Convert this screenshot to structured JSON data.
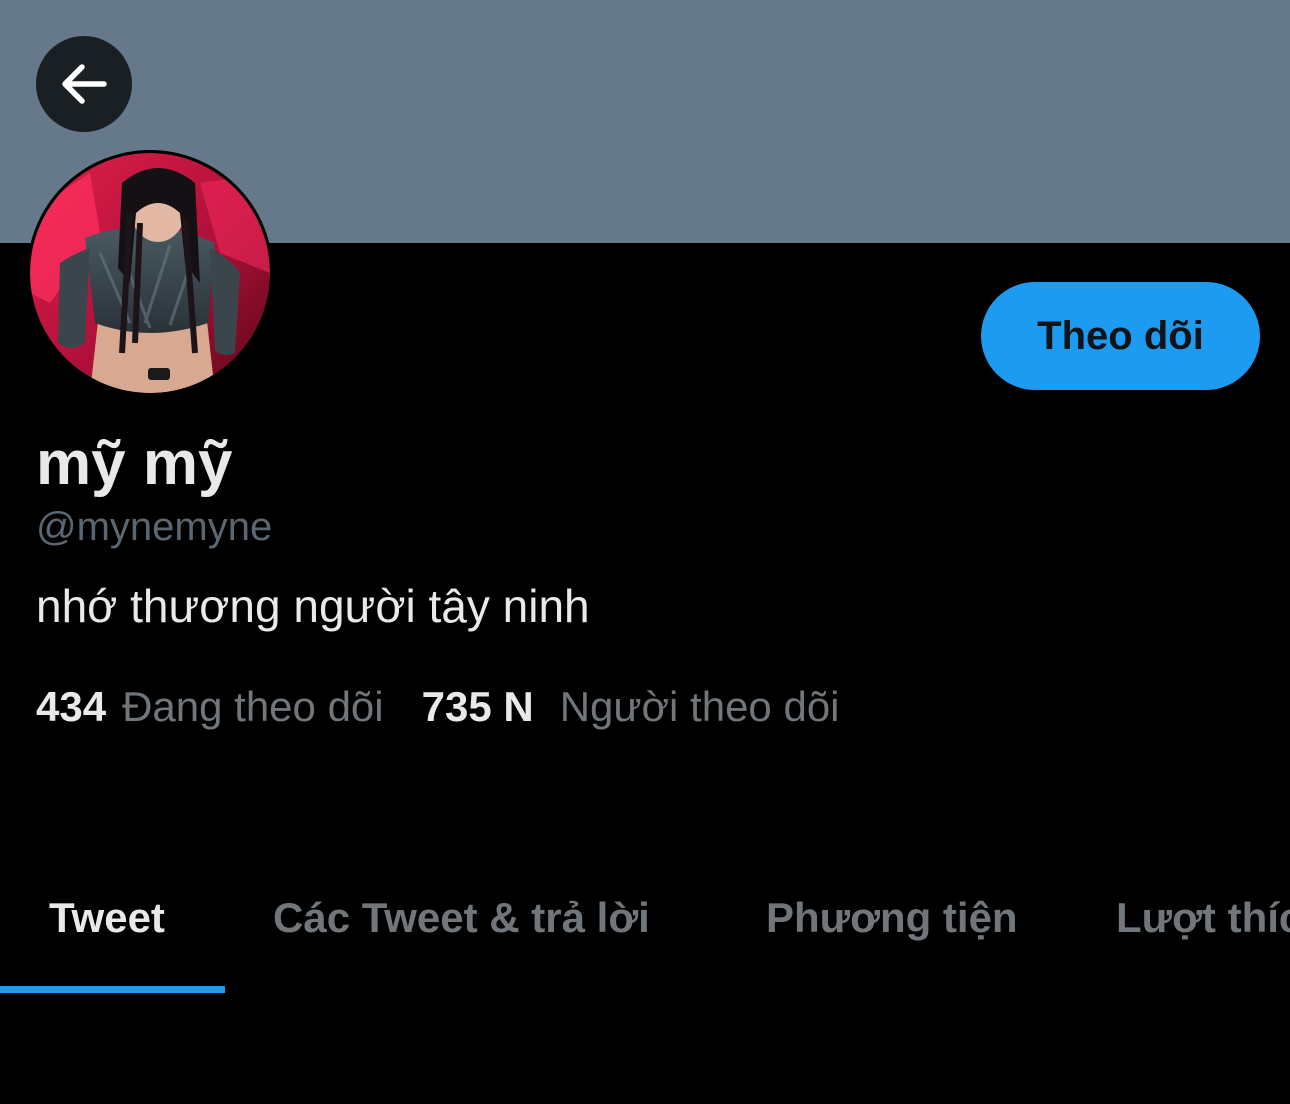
{
  "profile": {
    "display_name": "mỹ mỹ",
    "handle": "@mynemyne",
    "bio": "nhớ thương người tây ninh",
    "following_count": "434",
    "following_label": "Đang theo dõi",
    "followers_count": "735 N",
    "followers_label": "Người theo dõi"
  },
  "actions": {
    "follow_label": "Theo dõi"
  },
  "icons": {
    "back": "arrow-left-icon"
  },
  "tabs": [
    {
      "label": "Tweet",
      "active": true
    },
    {
      "label": "Các Tweet & trả lời",
      "active": false
    },
    {
      "label": "Phương tiện",
      "active": false
    },
    {
      "label": "Lượt thích",
      "active": false
    }
  ],
  "colors": {
    "banner": "#66798a",
    "accent": "#1d9bf0",
    "background": "#000000",
    "primary_text": "#e7e9ea",
    "secondary_text": "#71767b"
  }
}
